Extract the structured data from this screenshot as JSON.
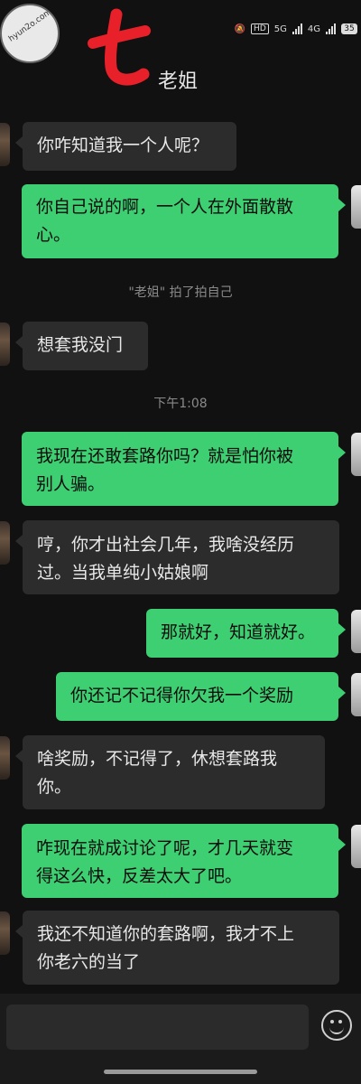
{
  "header": {
    "title": "老姐",
    "logo_char": "七",
    "watermark_text": "hyun2o.com"
  },
  "status": {
    "hd": "HD",
    "net1": "5G",
    "net2": "4G",
    "battery": "35"
  },
  "messages": [
    {
      "side": "in",
      "lines": [
        "你咋知道我一个人呢？"
      ]
    },
    {
      "side": "out",
      "lines": [
        "你自己说的啊，一个人在外面散散",
        "心。"
      ]
    },
    {
      "side": "system",
      "text": "\"老姐\" 拍了拍自己"
    },
    {
      "side": "in",
      "lines": [
        "想套我没门"
      ]
    },
    {
      "side": "time",
      "text": "下午1:08"
    },
    {
      "side": "out",
      "lines": [
        "我现在还敢套路你吗？就是怕你被",
        "别人骗。"
      ]
    },
    {
      "side": "in",
      "lines": [
        "哼，你才出社会几年，我啥没经历",
        "过。当我单纯小姑娘啊"
      ]
    },
    {
      "side": "out",
      "lines": [
        "那就好，知道就好。"
      ]
    },
    {
      "side": "out",
      "lines": [
        "你还记不记得你欠我一个奖励"
      ]
    },
    {
      "side": "in",
      "lines": [
        "啥奖励，不记得了，休想套路我",
        "你。"
      ]
    },
    {
      "side": "out",
      "lines": [
        "咋现在就成讨论了呢，才几天就变",
        "得这么快，反差太大了吧。"
      ]
    },
    {
      "side": "in",
      "lines": [
        "我还不知道你的套路啊，我才不上",
        "你老六的当了"
      ]
    }
  ],
  "colors": {
    "background": "#111111",
    "incoming_bubble": "#2c2c2c",
    "outgoing_bubble": "#3ecf72",
    "logo_red": "#e8202a"
  }
}
